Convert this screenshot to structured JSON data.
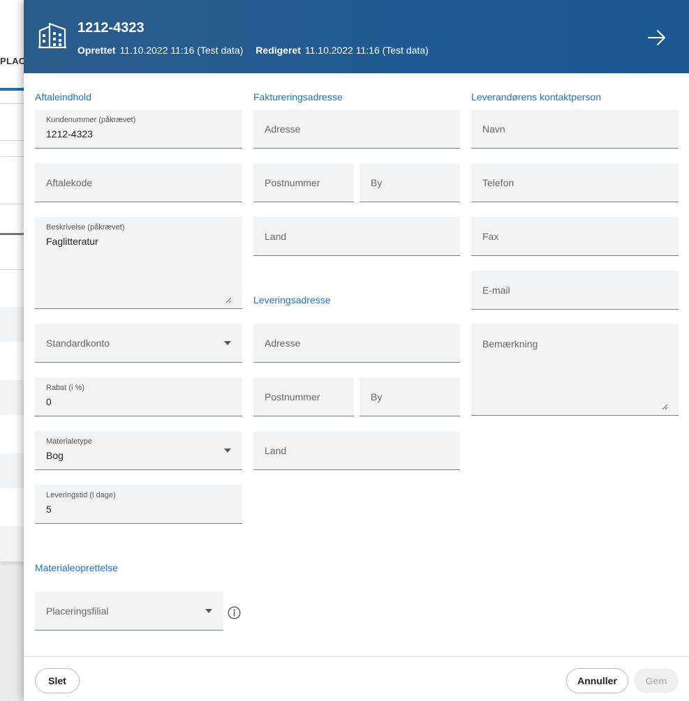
{
  "background": {
    "partial_text": "PLACE"
  },
  "header": {
    "title": "1212-4323",
    "created_label": "Oprettet",
    "created_value": "11.10.2022 11:16 (Test data)",
    "edited_label": "Redigeret",
    "edited_value": "11.10.2022 11:16 (Test data)",
    "icon": "building-icon",
    "close_icon": "arrow-right-icon"
  },
  "sections": {
    "agreement": "Aftaleindhold",
    "billing": "Faktureringsadresse",
    "delivery": "Leveringsadresse",
    "contact": "Leverandørens kontaktperson",
    "material": "Materialeoprettelse"
  },
  "agreement": {
    "customer_number_label": "Kundenummer (påkrævet)",
    "customer_number_value": "1212-4323",
    "agreement_code_placeholder": "Aftalekode",
    "description_label": "Beskrivelse (påkrævet)",
    "description_value": "Faglitteratur",
    "default_account_placeholder": "Standardkonto",
    "discount_label": "Rabat (i %)",
    "discount_value": "0",
    "material_type_label": "Materialetype",
    "material_type_value": "Bog",
    "delivery_time_label": "Leveringstid (i dage)",
    "delivery_time_value": "5"
  },
  "billing": {
    "address_placeholder": "Adresse",
    "postal_placeholder": "Postnummer",
    "city_placeholder": "By",
    "country_placeholder": "Land"
  },
  "delivery": {
    "address_placeholder": "Adresse",
    "postal_placeholder": "Postnummer",
    "city_placeholder": "By",
    "country_placeholder": "Land"
  },
  "contact": {
    "name_placeholder": "Navn",
    "phone_placeholder": "Telefon",
    "fax_placeholder": "Fax",
    "email_placeholder": "E-mail",
    "remark_placeholder": "Bemærkning"
  },
  "material": {
    "placement_branch_placeholder": "Placeringsfilial",
    "info_icon": "info-icon"
  },
  "footer": {
    "delete_label": "Slet",
    "cancel_label": "Annuller",
    "save_label": "Gem"
  },
  "colors": {
    "header_bg": "#1f5a92",
    "accent": "#1f72bd",
    "field_bg": "#f1f3f5"
  }
}
